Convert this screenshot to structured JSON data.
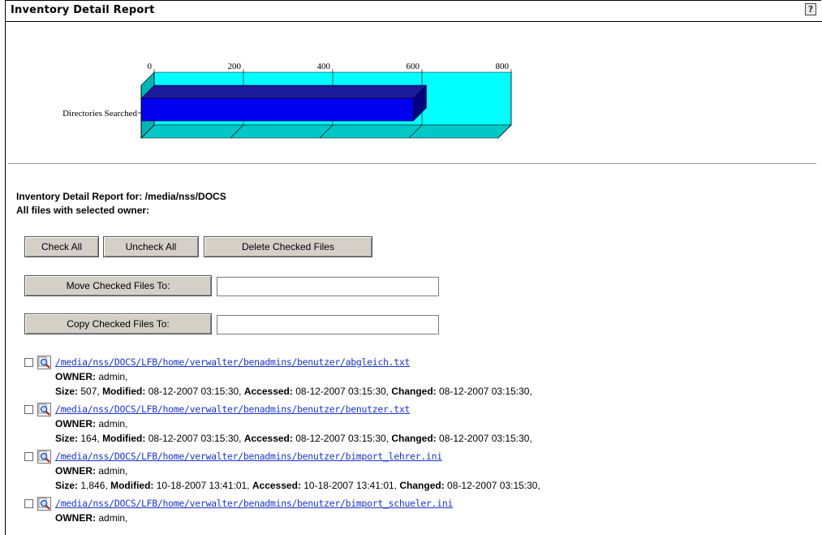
{
  "header": {
    "title": "Inventory Detail Report",
    "help_icon": "question-mark-icon"
  },
  "chart_data": {
    "type": "bar",
    "orientation": "horizontal",
    "style": "3d",
    "categories": [
      "Directories Searched"
    ],
    "values": [
      610
    ],
    "xlim": [
      0,
      800
    ],
    "ticks": [
      0,
      200,
      400,
      600,
      800
    ],
    "colors": {
      "bar": "#0000ee",
      "background": "#00ffff"
    }
  },
  "report": {
    "heading": "Inventory Detail Report for: /media/nss/DOCS",
    "subheading": "All files with selected owner:"
  },
  "buttons": {
    "check_all": "Check All",
    "uncheck_all": "Uncheck All",
    "delete_checked": "Delete Checked Files",
    "move_checked": "Move Checked Files To:",
    "copy_checked": "Copy Checked Files To:"
  },
  "fields": {
    "move_value": "",
    "copy_value": ""
  },
  "labels": {
    "owner": "OWNER:",
    "size": "Size:",
    "modified": "Modified:",
    "accessed": "Accessed:",
    "changed": "Changed:"
  },
  "files": [
    {
      "path": "/media/nss/DOCS/LFB/home/verwalter/benadmins/benutzer/abgleich.txt",
      "owner": "admin,",
      "size": "507,",
      "modified": "08-12-2007 03:15:30,",
      "accessed": "08-12-2007 03:15:30,",
      "changed": "08-12-2007 03:15:30,"
    },
    {
      "path": "/media/nss/DOCS/LFB/home/verwalter/benadmins/benutzer/benutzer.txt",
      "owner": "admin,",
      "size": "164,",
      "modified": "08-12-2007 03:15:30,",
      "accessed": "08-12-2007 03:15:30,",
      "changed": "08-12-2007 03:15:30,"
    },
    {
      "path": "/media/nss/DOCS/LFB/home/verwalter/benadmins/benutzer/bimport_lehrer.ini",
      "owner": "admin,",
      "size": "1,846,",
      "modified": "10-18-2007 13:41:01,",
      "accessed": "10-18-2007 13:41:01,",
      "changed": "08-12-2007 03:15:30,"
    },
    {
      "path": "/media/nss/DOCS/LFB/home/verwalter/benadmins/benutzer/bimport_schueler.ini",
      "owner": "admin,",
      "size": "",
      "modified": "",
      "accessed": "",
      "changed": ""
    }
  ]
}
